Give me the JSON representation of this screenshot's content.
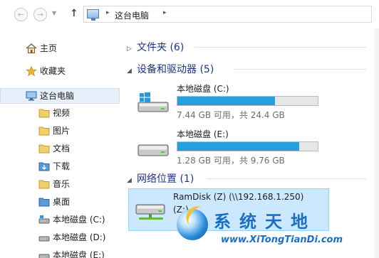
{
  "nav": {
    "back_glyph": "←",
    "forward_glyph": "→",
    "dropdown_glyph": "▼",
    "up_glyph": "↑"
  },
  "address": {
    "icon": "this-pc-icon",
    "separator": "▸",
    "crumb": "这台电脑"
  },
  "sidebar": {
    "items": [
      {
        "label": "主页",
        "icon": "home-icon"
      },
      {
        "label": "收藏夹",
        "icon": "star-icon"
      },
      {
        "label": "这台电脑",
        "icon": "this-pc-icon",
        "selected": true
      },
      {
        "label": "视频",
        "icon": "folder-icon"
      },
      {
        "label": "图片",
        "icon": "folder-icon"
      },
      {
        "label": "文档",
        "icon": "folder-icon"
      },
      {
        "label": "下载",
        "icon": "folder-icon"
      },
      {
        "label": "音乐",
        "icon": "folder-icon"
      },
      {
        "label": "桌面",
        "icon": "folder-icon"
      },
      {
        "label": "本地磁盘 (C:)",
        "icon": "drive-icon"
      },
      {
        "label": "本地磁盘 (D:)",
        "icon": "drive-icon"
      },
      {
        "label": "本地磁盘 (E:)",
        "icon": "drive-icon"
      }
    ]
  },
  "groups": {
    "folders": {
      "label": "文件夹 (6)",
      "expanded": false,
      "arrow": "▷"
    },
    "devices": {
      "label": "设备和驱动器 (5)",
      "expanded": true,
      "arrow": "◢"
    },
    "network": {
      "label": "网络位置 (1)",
      "expanded": true,
      "arrow": "◢"
    }
  },
  "drives": [
    {
      "name": "本地磁盘 (C:)",
      "info": "7.44 GB 可用，共 24.4 GB",
      "used_fraction": 0.695,
      "icon": "windows-drive-icon"
    },
    {
      "name": "本地磁盘 (E:)",
      "info": "1.28 GB 可用，共 9.76 GB",
      "used_fraction": 0.869,
      "icon": "drive-icon"
    }
  ],
  "network_location": {
    "name": "RamDisk (Z) (\\\\192.168.1.250)",
    "name_line2": "(Z:)",
    "icon": "network-drive-icon"
  },
  "watermark": {
    "title": "系统天地",
    "url": "www.XiTongTianDi.com"
  },
  "colors": {
    "bar_fill": "#26a0da",
    "selection": "#cce8ff",
    "group_heading": "#1e3287"
  }
}
